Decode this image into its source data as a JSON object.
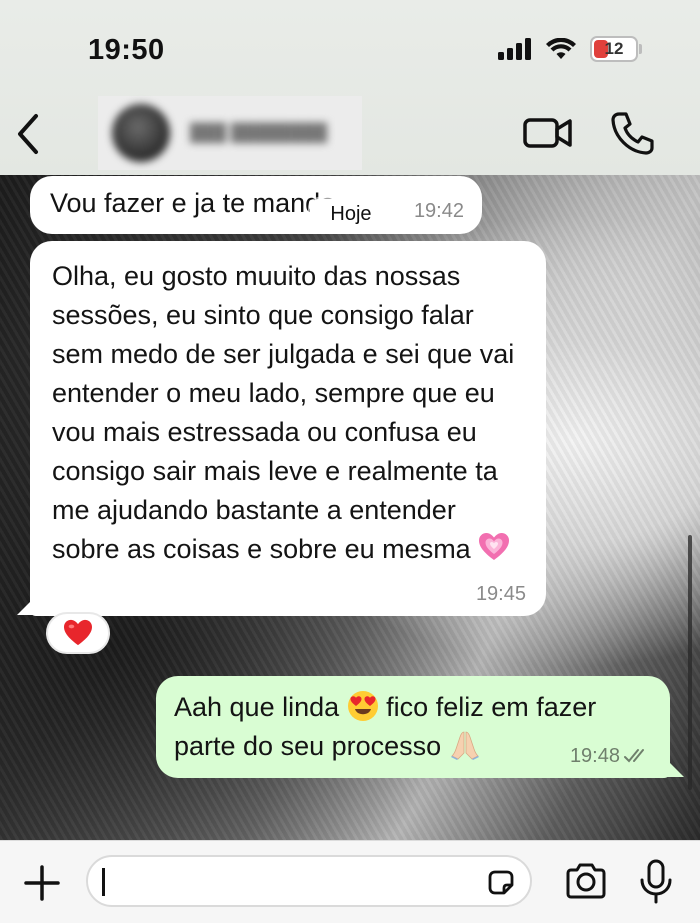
{
  "status_bar": {
    "time": "19:50",
    "battery_level": "12",
    "battery_color": "#e0403c"
  },
  "chat_header": {
    "back_icon": "chevron-left-icon",
    "video_call_icon": "video-camera-icon",
    "voice_call_icon": "phone-icon"
  },
  "date_separator": "Hoje",
  "messages": [
    {
      "direction": "incoming",
      "text": "Vou fazer e ja te mando",
      "time": "19:42"
    },
    {
      "direction": "incoming",
      "text": "Olha, eu gosto muuito das nossas sessões, eu sinto que consigo falar sem medo de ser julgada e sei que vai entender o meu lado, sempre que eu vou mais estressada ou confusa eu consigo sair mais leve e realmente ta me ajudando bastante a entender sobre as coisas e sobre eu mesma",
      "emoji": "growing-pink-heart",
      "time": "19:45",
      "reaction": "red-heart"
    },
    {
      "direction": "outgoing",
      "text_part1": "Aah que linda",
      "emoji1": "heart-eyes-face",
      "text_part2": "fico feliz em fazer parte do seu processo",
      "emoji2": "folded-hands",
      "time": "19:48",
      "status": "read",
      "bubble_color": "#d9fdd3"
    }
  ],
  "composer": {
    "plus_icon": "plus-icon",
    "sticker_icon": "sticker-icon",
    "camera_icon": "camera-icon",
    "mic_icon": "microphone-icon",
    "value": ""
  }
}
